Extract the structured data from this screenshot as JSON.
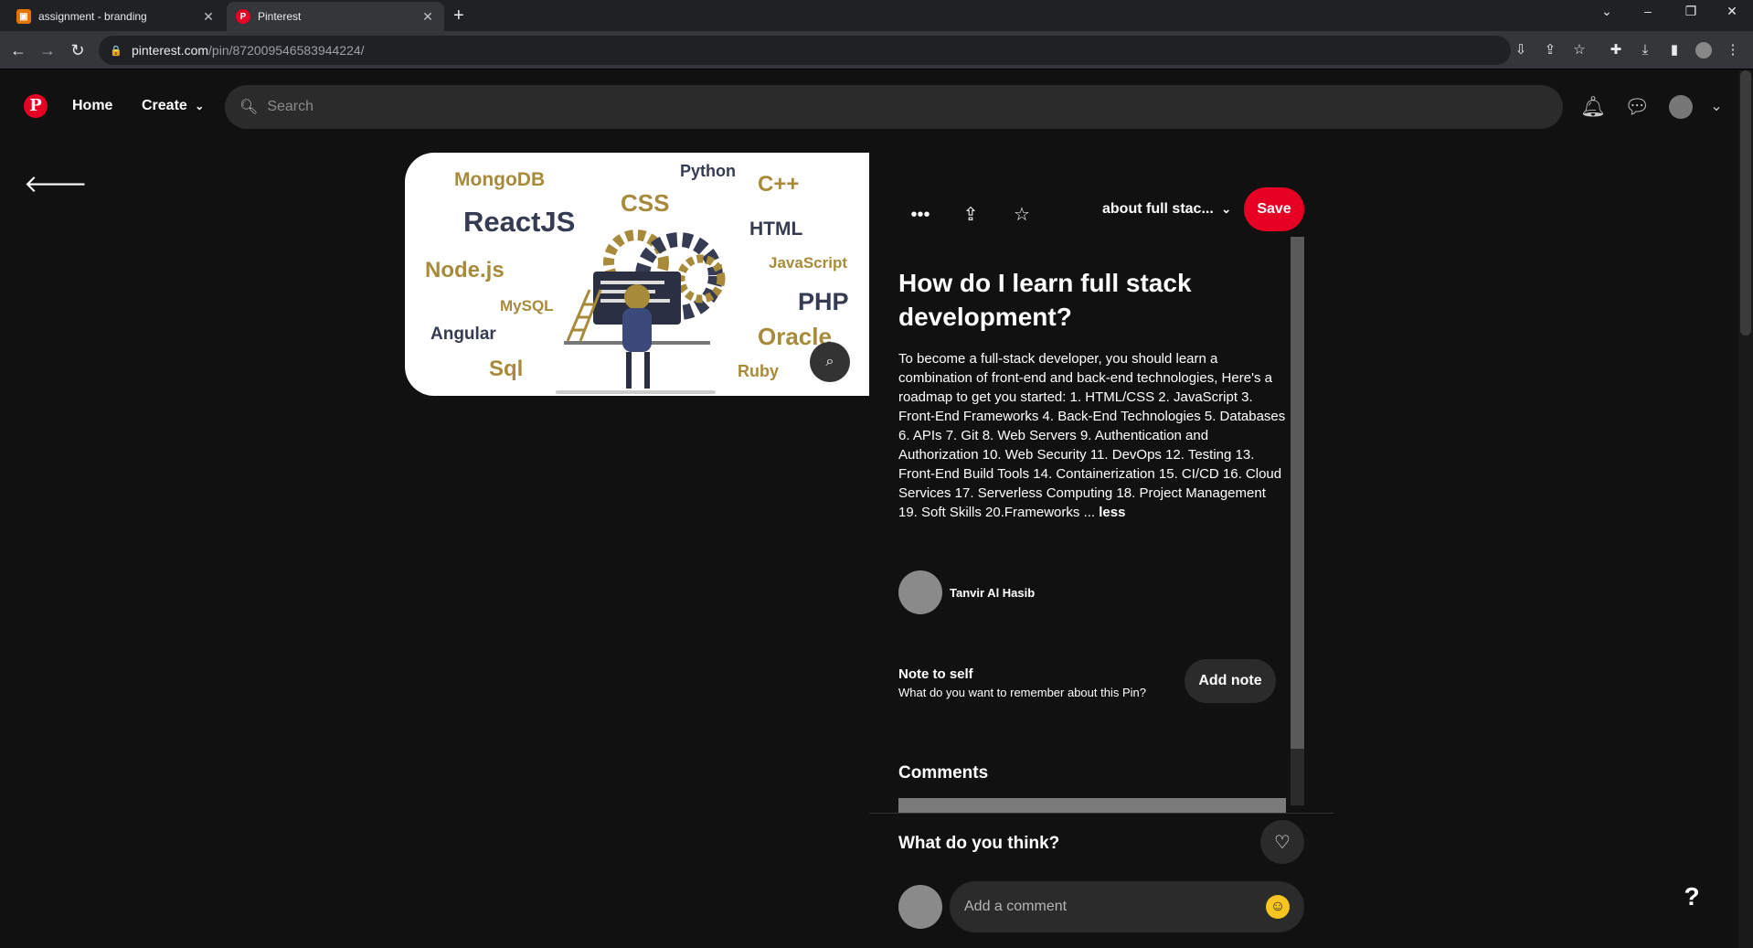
{
  "browser": {
    "tabs": [
      {
        "title": "assignment - branding",
        "favicon": "O",
        "favicon_color": "#e37400"
      },
      {
        "title": "Pinterest",
        "favicon": "P",
        "favicon_color": "#e60023"
      }
    ],
    "url_host": "pinterest.com",
    "url_path": "/pin/872009546583944224/"
  },
  "header": {
    "logo": "P",
    "home": "Home",
    "create": "Create",
    "search_placeholder": "Search"
  },
  "pin": {
    "image_words": [
      "MongoDB",
      "Python",
      "C++",
      "CSS",
      "ReactJS",
      "HTML",
      "Node.js",
      "JavaScript",
      "MySQL",
      "PHP",
      "Angular",
      "Oracle",
      "Sql",
      "Ruby"
    ],
    "board": "about full stac...",
    "save_label": "Save",
    "title": "How do I learn full stack development?",
    "description": "To become a full-stack developer, you should learn a combination of front-end and back-end technologies, Here's a roadmap to get you started: 1. HTML/CSS 2. JavaScript 3. Front-End Frameworks 4. Back-End Technologies 5. Databases 6. APIs 7. Git 8. Web Servers 9. Authentication and Authorization 10. Web Security 11. DevOps 12. Testing 13. Front-End Build Tools 14. Containerization 15. CI/CD 16. Cloud Services 17. Serverless Computing 18. Project Management 19. Soft Skills 20.Frameworks ...",
    "less_label": "less",
    "author": "Tanvir Al Hasib",
    "note_title": "Note to self",
    "note_sub": "What do you want to remember about this Pin?",
    "add_note": "Add note",
    "comments_heading": "Comments",
    "think_heading": "What do you think?",
    "comment_placeholder": "Add a comment"
  },
  "help": "?",
  "colors": {
    "brand": "#e60023",
    "surface": "#2b2b2b"
  }
}
